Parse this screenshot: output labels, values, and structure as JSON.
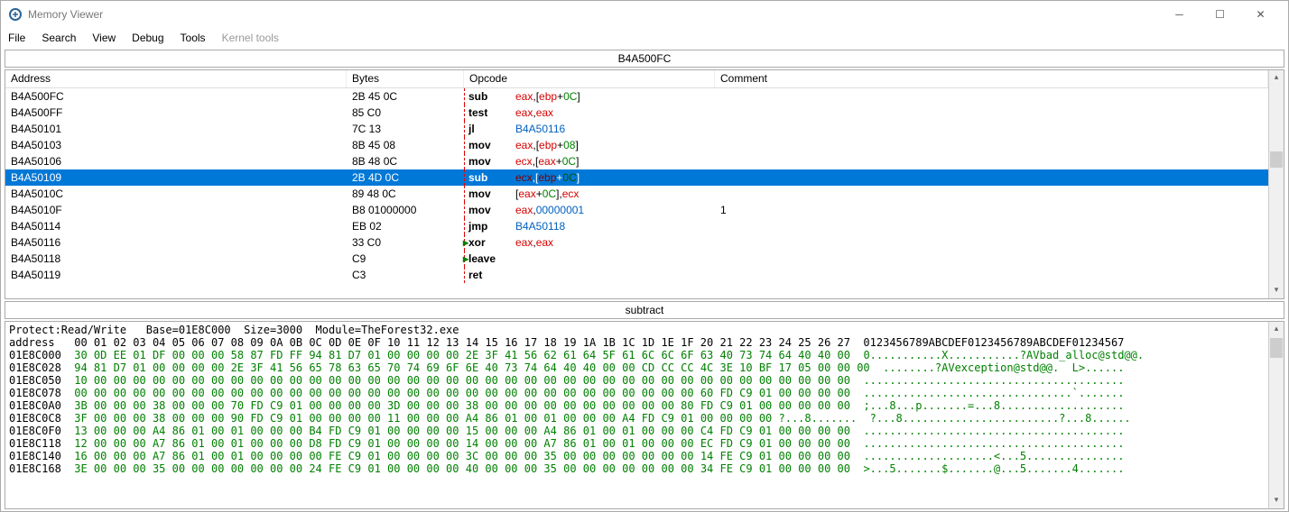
{
  "window": {
    "title": "Memory Viewer"
  },
  "menu": {
    "file": "File",
    "search": "Search",
    "view": "View",
    "debug": "Debug",
    "tools": "Tools",
    "kernel": "Kernel tools"
  },
  "address_bar": "B4A500FC",
  "columns": {
    "address": "Address",
    "bytes": "Bytes",
    "opcode": "Opcode",
    "comment": "Comment"
  },
  "rows": [
    {
      "addr": "B4A500FC",
      "bytes": "2B 45 0C",
      "mnem": "sub",
      "ops": [
        {
          "t": "reg",
          "v": "eax"
        },
        {
          "t": "txt",
          "v": ",["
        },
        {
          "t": "reg",
          "v": "ebp"
        },
        {
          "t": "txt",
          "v": "+"
        },
        {
          "t": "off",
          "v": "0C"
        },
        {
          "t": "txt",
          "v": "]"
        }
      ],
      "com": ""
    },
    {
      "addr": "B4A500FF",
      "bytes": "85 C0",
      "mnem": "test",
      "ops": [
        {
          "t": "reg",
          "v": "eax"
        },
        {
          "t": "txt",
          "v": ","
        },
        {
          "t": "reg",
          "v": "eax"
        }
      ],
      "com": ""
    },
    {
      "addr": "B4A50101",
      "bytes": "7C 13",
      "mnem": "jl",
      "ops": [
        {
          "t": "addr",
          "v": "B4A50116"
        }
      ],
      "com": ""
    },
    {
      "addr": "B4A50103",
      "bytes": "8B 45 08",
      "mnem": "mov",
      "ops": [
        {
          "t": "reg",
          "v": "eax"
        },
        {
          "t": "txt",
          "v": ",["
        },
        {
          "t": "reg",
          "v": "ebp"
        },
        {
          "t": "txt",
          "v": "+"
        },
        {
          "t": "off",
          "v": "08"
        },
        {
          "t": "txt",
          "v": "]"
        }
      ],
      "com": ""
    },
    {
      "addr": "B4A50106",
      "bytes": "8B 48 0C",
      "mnem": "mov",
      "ops": [
        {
          "t": "reg",
          "v": "ecx"
        },
        {
          "t": "txt",
          "v": ",["
        },
        {
          "t": "reg",
          "v": "eax"
        },
        {
          "t": "txt",
          "v": "+"
        },
        {
          "t": "off",
          "v": "0C"
        },
        {
          "t": "txt",
          "v": "]"
        }
      ],
      "com": ""
    },
    {
      "addr": "B4A50109",
      "bytes": "2B 4D 0C",
      "mnem": "sub",
      "ops": [
        {
          "t": "reg",
          "v": "ecx"
        },
        {
          "t": "txt",
          "v": ",["
        },
        {
          "t": "reg",
          "v": "ebp"
        },
        {
          "t": "txt",
          "v": "+"
        },
        {
          "t": "off",
          "v": "0C"
        },
        {
          "t": "txt",
          "v": "]"
        }
      ],
      "com": "",
      "sel": true
    },
    {
      "addr": "B4A5010C",
      "bytes": "89 48 0C",
      "mnem": "mov",
      "ops": [
        {
          "t": "txt",
          "v": "["
        },
        {
          "t": "reg",
          "v": "eax"
        },
        {
          "t": "txt",
          "v": "+"
        },
        {
          "t": "off",
          "v": "0C"
        },
        {
          "t": "txt",
          "v": "],"
        },
        {
          "t": "reg",
          "v": "ecx"
        }
      ],
      "com": ""
    },
    {
      "addr": "B4A5010F",
      "bytes": "B8 01000000",
      "mnem": "mov",
      "ops": [
        {
          "t": "reg",
          "v": "eax"
        },
        {
          "t": "txt",
          "v": ","
        },
        {
          "t": "addr",
          "v": "00000001"
        }
      ],
      "com": "1"
    },
    {
      "addr": "B4A50114",
      "bytes": "EB 02",
      "mnem": "jmp",
      "ops": [
        {
          "t": "addr",
          "v": "B4A50118"
        }
      ],
      "com": ""
    },
    {
      "addr": "B4A50116",
      "bytes": "33 C0",
      "mnem": "xor",
      "ops": [
        {
          "t": "reg",
          "v": "eax"
        },
        {
          "t": "txt",
          "v": ","
        },
        {
          "t": "reg",
          "v": "eax"
        }
      ],
      "com": "",
      "arrow": true
    },
    {
      "addr": "B4A50118",
      "bytes": "C9",
      "mnem": "leave",
      "ops": [],
      "com": "",
      "arrow": true
    },
    {
      "addr": "B4A50119",
      "bytes": "C3",
      "mnem": "ret",
      "ops": [],
      "com": ""
    }
  ],
  "hint": "subtract",
  "hex_info": "Protect:Read/Write   Base=01E8C000  Size=3000  Module=TheForest32.exe",
  "hex_header": "address   00 01 02 03 04 05 06 07 08 09 0A 0B 0C 0D 0E 0F 10 11 12 13 14 15 16 17 18 19 1A 1B 1C 1D 1E 1F 20 21 22 23 24 25 26 27  0123456789ABCDEF0123456789ABCDEF01234567",
  "hex_rows": [
    {
      "a": "01E8C000",
      "b": "30 0D EE 01 DF 00 00 00 58 87 FD FF 94 81 D7 01 00 00 00 00 2E 3F 41 56 62 61 64 5F 61 6C 6C 6F 63 40 73 74 64 40 40 00",
      "asc": "0...........X...........?AVbad_alloc@std@@."
    },
    {
      "a": "01E8C028",
      "b": "94 81 D7 01 00 00 00 00 2E 3F 41 56 65 78 63 65 70 74 69 6F 6E 40 73 74 64 40 40 00 00 CD CC CC 4C 3E 10 BF 17 05 00 00 00",
      "asc": "........?AVexception@std@@.  L>......"
    },
    {
      "a": "01E8C050",
      "b": "10 00 00 00 00 00 00 00 00 00 00 00 00 00 00 00 00 00 00 00 00 00 00 00 00 00 00 00 00 00 00 00 00 00 00 00 00 00 00 00",
      "asc": "........................................"
    },
    {
      "a": "01E8C078",
      "b": "00 00 00 00 00 00 00 00 00 00 00 00 00 00 00 00 00 00 00 00 00 00 00 00 00 00 00 00 00 00 00 00 60 FD C9 01 00 00 00 00",
      "asc": "................................`......."
    },
    {
      "a": "01E8C0A0",
      "b": "3B 00 00 00 38 00 00 00 70 FD C9 01 00 00 00 00 3D 00 00 00 38 00 00 00 00 00 00 00 00 00 00 80 FD C9 01 00 00 00 00 00",
      "asc": ";...8...p.......=...8..................."
    },
    {
      "a": "01E8C0C8",
      "b": "3F 00 00 00 38 00 00 00 90 FD C9 01 00 00 00 00 11 00 00 00 A4 86 01 00 01 00 00 00 A4 FD C9 01 00 00 00 00 ?...8.......",
      "asc": "?...8........................?...8......"
    },
    {
      "a": "01E8C0F0",
      "b": "13 00 00 00 A4 86 01 00 01 00 00 00 B4 FD C9 01 00 00 00 00 15 00 00 00 A4 86 01 00 01 00 00 00 C4 FD C9 01 00 00 00 00",
      "asc": "........................................"
    },
    {
      "a": "01E8C118",
      "b": "12 00 00 00 A7 86 01 00 01 00 00 00 D8 FD C9 01 00 00 00 00 14 00 00 00 A7 86 01 00 01 00 00 00 EC FD C9 01 00 00 00 00",
      "asc": "........................................"
    },
    {
      "a": "01E8C140",
      "b": "16 00 00 00 A7 86 01 00 01 00 00 00 00 FE C9 01 00 00 00 00 3C 00 00 00 35 00 00 00 00 00 00 00 14 FE C9 01 00 00 00 00",
      "asc": "....................<...5..............."
    },
    {
      "a": "01E8C168",
      "b": "3E 00 00 00 35 00 00 00 00 00 00 00 24 FE C9 01 00 00 00 00 40 00 00 00 35 00 00 00 00 00 00 00 34 FE C9 01 00 00 00 00",
      "asc": ">...5.......$.......@...5.......4......."
    }
  ]
}
